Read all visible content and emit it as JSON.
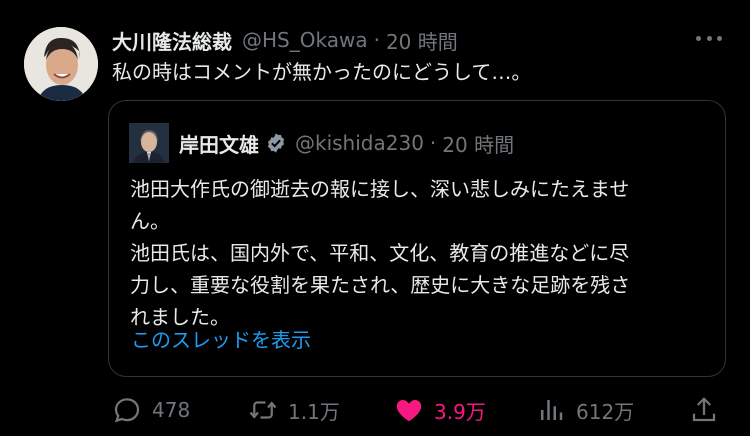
{
  "tweet": {
    "display_name": "大川隆法総裁",
    "handle": "@HS_Okawa",
    "separator": "·",
    "time": "20 時間",
    "text": "私の時はコメントが無かったのにどうして…。"
  },
  "quote": {
    "display_name": "岸田文雄",
    "handle": "@kishida230",
    "separator": "·",
    "time": "20 時間",
    "lines": [
      "池田大作氏の御逝去の報に接し、深い悲しみにたえませ",
      "ん。",
      "池田氏は、国内外で、平和、文化、教育の推進などに尽",
      "力し、重要な役割を果たされ、歴史に大きな足跡を残さ",
      "れました。"
    ],
    "show_thread": "このスレッドを表示"
  },
  "actions": {
    "replies": "478",
    "retweets": "1.1万",
    "likes": "3.9万",
    "views": "612万"
  },
  "colors": {
    "background": "#000000",
    "text": "#e7e9ea",
    "muted": "#71767b",
    "link": "#1d9bf0",
    "like": "#f91880",
    "border": "#2f3336"
  },
  "icons": [
    "more-icon",
    "verified-icon",
    "reply-icon",
    "retweet-icon",
    "heart-icon",
    "views-icon",
    "share-icon"
  ]
}
